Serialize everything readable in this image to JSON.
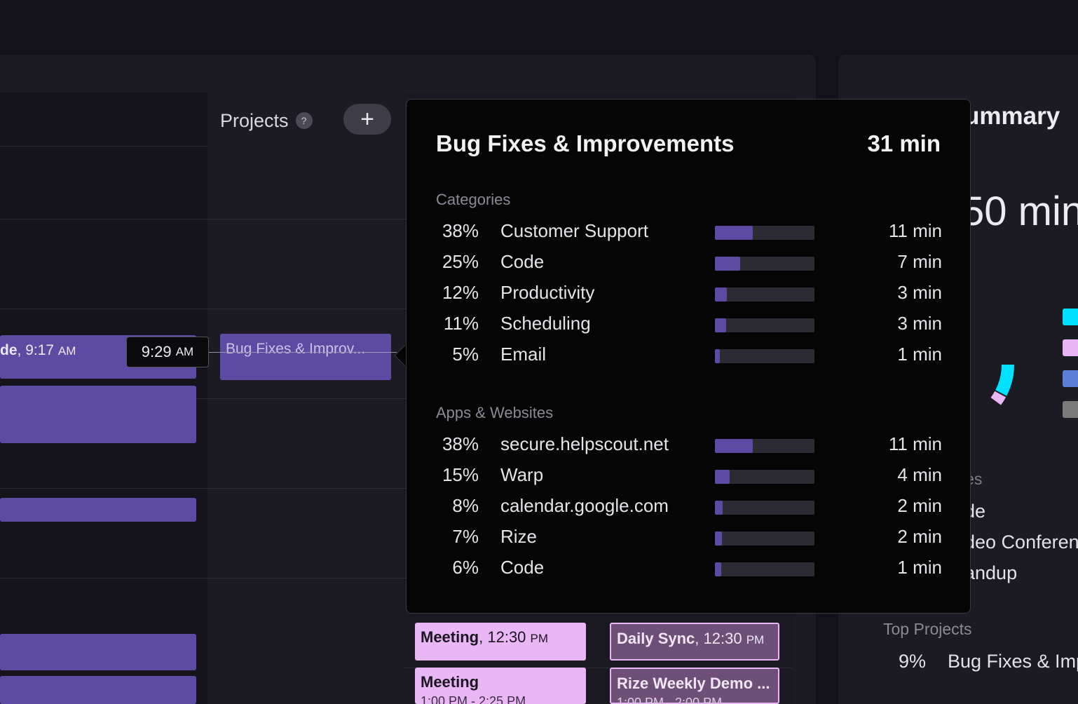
{
  "projects_column": {
    "title": "Projects",
    "help_glyph": "?",
    "add_glyph": "+"
  },
  "calendar": {
    "event_label_bold": "de",
    "event_label_time": "9:17",
    "event_label_ampm": "AM",
    "time_tag": "9:29",
    "time_tag_ampm": "AM"
  },
  "project_block": {
    "label": "Bug Fixes & Improv..."
  },
  "meetings": [
    {
      "title": "Meeting",
      "time": "12:30",
      "ampm": "PM",
      "sub": ""
    },
    {
      "title": "Meeting",
      "time": "",
      "ampm": "",
      "sub": "1:00 PM - 2:25 PM"
    }
  ],
  "syncs": [
    {
      "title": "Daily Sync",
      "time": "12:30",
      "ampm": "PM",
      "sub": ""
    },
    {
      "title": "Rize Weekly Demo ...",
      "time": "",
      "ampm": "",
      "sub": "1:00 PM - 2:00 PM"
    }
  ],
  "summary": {
    "title": "ummary",
    "sub": "s",
    "total": "50 min",
    "categories_heading": "ies",
    "categories": [
      "de",
      "deo Conferen",
      "andup"
    ],
    "legend_colors": [
      "#00e0ff",
      "#eab7f5",
      "#5b7fd9",
      "#7a7a7a"
    ],
    "top_projects_heading": "Top Projects",
    "top_project": {
      "pct": "9%",
      "name": "Bug Fixes & Imp"
    }
  },
  "popover": {
    "title": "Bug Fixes & Improvements",
    "total": "31 min",
    "categories_heading": "Categories",
    "categories": [
      {
        "pct": "38%",
        "name": "Customer Support",
        "fraction": 0.38,
        "duration": "11 min"
      },
      {
        "pct": "25%",
        "name": "Code",
        "fraction": 0.25,
        "duration": "7 min"
      },
      {
        "pct": "12%",
        "name": "Productivity",
        "fraction": 0.12,
        "duration": "3 min"
      },
      {
        "pct": "11%",
        "name": "Scheduling",
        "fraction": 0.11,
        "duration": "3 min"
      },
      {
        "pct": "5%",
        "name": "Email",
        "fraction": 0.05,
        "duration": "1 min"
      }
    ],
    "apps_heading": "Apps & Websites",
    "apps": [
      {
        "pct": "38%",
        "name": "secure.helpscout.net",
        "fraction": 0.38,
        "duration": "11 min"
      },
      {
        "pct": "15%",
        "name": "Warp",
        "fraction": 0.15,
        "duration": "4 min"
      },
      {
        "pct": "8%",
        "name": "calendar.google.com",
        "fraction": 0.08,
        "duration": "2 min"
      },
      {
        "pct": "7%",
        "name": "Rize",
        "fraction": 0.07,
        "duration": "2 min"
      },
      {
        "pct": "6%",
        "name": "Code",
        "fraction": 0.06,
        "duration": "1 min"
      }
    ]
  }
}
